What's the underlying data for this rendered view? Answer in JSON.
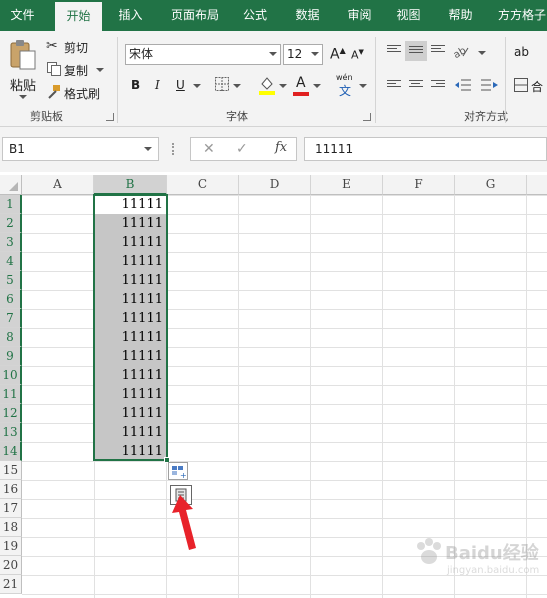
{
  "ribbon_tabs": [
    "文件",
    "开始",
    "插入",
    "页面布局",
    "公式",
    "数据",
    "审阅",
    "视图",
    "帮助",
    "方方格子"
  ],
  "active_tab": "开始",
  "clipboard": {
    "paste": "粘贴",
    "cut": "剪切",
    "copy": "复制",
    "format_painter": "格式刷",
    "label": "剪贴板"
  },
  "font": {
    "name": "宋体",
    "size": "12",
    "bold": "B",
    "italic": "I",
    "underline": "U",
    "grow": "A",
    "shrink": "A",
    "font_color_glyph": "A",
    "phonetic": "wén",
    "phonetic_char": "文",
    "label": "字体"
  },
  "alignment": {
    "label": "对齐方式",
    "wrap_glyph": "ab",
    "merge_glyph": "合"
  },
  "formula_bar": {
    "name_box": "B1",
    "cancel": "✕",
    "enter": "✓",
    "fx": "fx",
    "value": "11111"
  },
  "columns": [
    "A",
    "B",
    "C",
    "D",
    "E",
    "F",
    "G"
  ],
  "rows": [
    "1",
    "2",
    "3",
    "4",
    "5",
    "6",
    "7",
    "8",
    "9",
    "10",
    "11",
    "12",
    "13",
    "14",
    "15",
    "16",
    "17",
    "18",
    "19",
    "20",
    "21"
  ],
  "selected_column": "B",
  "cells_b": [
    "11111",
    "11111",
    "11111",
    "11111",
    "11111",
    "11111",
    "11111",
    "11111",
    "11111",
    "11111",
    "11111",
    "11111",
    "11111",
    "11111"
  ],
  "watermark": {
    "brand": "Baidu经验",
    "url": "jingyan.baidu.com"
  },
  "colors": {
    "accent": "#217346",
    "selection": "#c6c6c6",
    "arrow": "#e8222a"
  }
}
